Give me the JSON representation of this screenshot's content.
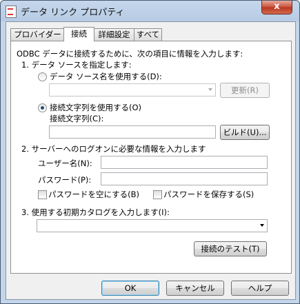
{
  "window": {
    "title": "データ リンク プロパティ",
    "close": "x"
  },
  "tabs": [
    {
      "label": "プロバイダー"
    },
    {
      "label": "接続"
    },
    {
      "label": "詳細設定"
    },
    {
      "label": "すべて"
    }
  ],
  "connection": {
    "intro": "ODBC データに接続するために、次の項目に情報を入力します:",
    "step1": "1. データ ソースを指定します:",
    "use_dsn_label": "データ ソース名を使用する(D):",
    "use_dsn_selected": false,
    "dsn_value": "",
    "refresh_label": "更新(R)",
    "use_connstr_label": "接続文字列を使用する(O)",
    "use_connstr_selected": true,
    "connstr_caption": "接続文字列(C):",
    "connstr_value": "",
    "build_label": "ビルド(U)...",
    "step2": "2. サーバーへのログオンに必要な情報を入力します",
    "username_label": "ユーザー名(N):",
    "username_value": "",
    "password_label": "パスワード(P):",
    "password_value": "",
    "blank_password_label": "パスワードを空にする(B)",
    "blank_password_checked": false,
    "save_password_label": "パスワードを保存する(S)",
    "save_password_checked": false,
    "step3": "3. 使用する初期カタログを入力します(I):",
    "catalog_value": "",
    "test_label": "接続のテスト(T)"
  },
  "footer": {
    "ok": "OK",
    "cancel": "キャンセル",
    "help": "ヘルプ"
  }
}
